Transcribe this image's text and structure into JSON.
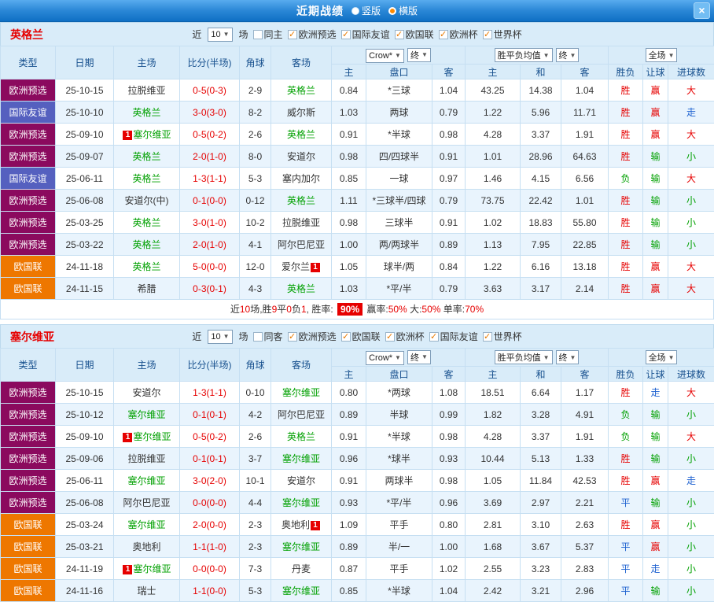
{
  "titlebar": {
    "title": "近期战绩",
    "vertical_label": "竖版",
    "horizontal_label": "横版",
    "close_glyph": "×"
  },
  "columns": {
    "main": [
      "类型",
      "日期",
      "主场",
      "比分(半场)",
      "角球",
      "客场"
    ],
    "sub": [
      "主",
      "盘口",
      "客",
      "主",
      "和",
      "客",
      "胜负",
      "让球",
      "进球数"
    ],
    "company_dd": "Crow*",
    "final_dd": "终",
    "avg_dd": "胜平负均值",
    "final_dd2": "终",
    "scope_dd": "全场"
  },
  "colors": {
    "type": {
      "欧洲预选": "#8b0a5e",
      "国际友谊": "#5560bf",
      "欧国联": "#ee7700"
    },
    "result": {
      "r": "#e60000",
      "g": "#00a000",
      "b": "#1e62d0"
    },
    "accent": "#e60000",
    "header_bg": "#d9ecf9"
  },
  "sections": [
    {
      "team": "英格兰",
      "filter": {
        "near": "近",
        "count": "10",
        "games": "场",
        "same_label": "同主",
        "same_checked": false,
        "comps": [
          "欧洲预选",
          "国际友谊",
          "欧国联",
          "欧洲杯",
          "世界杯"
        ]
      },
      "rows": [
        {
          "type": "欧洲预选",
          "date": "25-10-15",
          "home": {
            "name": "拉脱维亚"
          },
          "score": "0-5(0-3)",
          "corner": "2-9",
          "away": {
            "name": "英格兰",
            "green": true
          },
          "odds": [
            "0.84",
            "*三球",
            "1.04"
          ],
          "avg": [
            "43.25",
            "14.38",
            "1.04"
          ],
          "res": [
            "胜",
            "赢",
            "大"
          ],
          "res_c": [
            "r",
            "r",
            "r"
          ]
        },
        {
          "type": "国际友谊",
          "date": "25-10-10",
          "home": {
            "name": "英格兰",
            "green": true
          },
          "score": "3-0(3-0)",
          "corner": "8-2",
          "away": {
            "name": "威尔斯"
          },
          "odds": [
            "1.03",
            "两球",
            "0.79"
          ],
          "avg": [
            "1.22",
            "5.96",
            "11.71"
          ],
          "res": [
            "胜",
            "赢",
            "走"
          ],
          "res_c": [
            "r",
            "r",
            "b"
          ]
        },
        {
          "type": "欧洲预选",
          "date": "25-09-10",
          "home": {
            "name": "塞尔维亚",
            "green": true,
            "badge": "1",
            "badge_pos": "before"
          },
          "score": "0-5(0-2)",
          "corner": "2-6",
          "away": {
            "name": "英格兰",
            "green": true
          },
          "odds": [
            "0.91",
            "*半球",
            "0.98"
          ],
          "avg": [
            "4.28",
            "3.37",
            "1.91"
          ],
          "res": [
            "胜",
            "赢",
            "大"
          ],
          "res_c": [
            "r",
            "r",
            "r"
          ]
        },
        {
          "type": "欧洲预选",
          "date": "25-09-07",
          "home": {
            "name": "英格兰",
            "green": true
          },
          "score": "2-0(1-0)",
          "corner": "8-0",
          "away": {
            "name": "安道尔"
          },
          "odds": [
            "0.98",
            "四/四球半",
            "0.91"
          ],
          "avg": [
            "1.01",
            "28.96",
            "64.63"
          ],
          "res": [
            "胜",
            "输",
            "小"
          ],
          "res_c": [
            "r",
            "g",
            "g"
          ]
        },
        {
          "type": "国际友谊",
          "date": "25-06-11",
          "home": {
            "name": "英格兰",
            "green": true
          },
          "score": "1-3(1-1)",
          "corner": "5-3",
          "away": {
            "name": "塞内加尔"
          },
          "odds": [
            "0.85",
            "一球",
            "0.97"
          ],
          "avg": [
            "1.46",
            "4.15",
            "6.56"
          ],
          "res": [
            "负",
            "输",
            "大"
          ],
          "res_c": [
            "g",
            "g",
            "r"
          ]
        },
        {
          "type": "欧洲预选",
          "date": "25-06-08",
          "home": {
            "name": "安道尔(中)"
          },
          "score": "0-1(0-0)",
          "corner": "0-12",
          "away": {
            "name": "英格兰",
            "green": true
          },
          "odds": [
            "1.11",
            "*三球半/四球",
            "0.79"
          ],
          "avg": [
            "73.75",
            "22.42",
            "1.01"
          ],
          "res": [
            "胜",
            "输",
            "小"
          ],
          "res_c": [
            "r",
            "g",
            "g"
          ]
        },
        {
          "type": "欧洲预选",
          "date": "25-03-25",
          "home": {
            "name": "英格兰",
            "green": true
          },
          "score": "3-0(1-0)",
          "corner": "10-2",
          "away": {
            "name": "拉脱维亚"
          },
          "odds": [
            "0.98",
            "三球半",
            "0.91"
          ],
          "avg": [
            "1.02",
            "18.83",
            "55.80"
          ],
          "res": [
            "胜",
            "输",
            "小"
          ],
          "res_c": [
            "r",
            "g",
            "g"
          ]
        },
        {
          "type": "欧洲预选",
          "date": "25-03-22",
          "home": {
            "name": "英格兰",
            "green": true
          },
          "score": "2-0(1-0)",
          "corner": "4-1",
          "away": {
            "name": "阿尔巴尼亚"
          },
          "odds": [
            "1.00",
            "两/两球半",
            "0.89"
          ],
          "avg": [
            "1.13",
            "7.95",
            "22.85"
          ],
          "res": [
            "胜",
            "输",
            "小"
          ],
          "res_c": [
            "r",
            "g",
            "g"
          ]
        },
        {
          "type": "欧国联",
          "date": "24-11-18",
          "home": {
            "name": "英格兰",
            "green": true
          },
          "score": "5-0(0-0)",
          "corner": "12-0",
          "away": {
            "name": "爱尔兰",
            "badge": "1",
            "badge_pos": "after"
          },
          "odds": [
            "1.05",
            "球半/两",
            "0.84"
          ],
          "avg": [
            "1.22",
            "6.16",
            "13.18"
          ],
          "res": [
            "胜",
            "赢",
            "大"
          ],
          "res_c": [
            "r",
            "r",
            "r"
          ]
        },
        {
          "type": "欧国联",
          "date": "24-11-15",
          "home": {
            "name": "希腊"
          },
          "score": "0-3(0-1)",
          "corner": "4-3",
          "away": {
            "name": "英格兰",
            "green": true
          },
          "odds": [
            "1.03",
            "*平/半",
            "0.79"
          ],
          "avg": [
            "3.63",
            "3.17",
            "2.14"
          ],
          "res": [
            "胜",
            "赢",
            "大"
          ],
          "res_c": [
            "r",
            "r",
            "r"
          ]
        }
      ],
      "summary": [
        {
          "t": "近"
        },
        {
          "t": "10",
          "c": "red"
        },
        {
          "t": "场,胜"
        },
        {
          "t": "9",
          "c": "red"
        },
        {
          "t": "平"
        },
        {
          "t": "0",
          "c": "red"
        },
        {
          "t": "负"
        },
        {
          "t": "1",
          "c": "red"
        },
        {
          "t": ", 胜率: "
        },
        {
          "t": "90%",
          "c": "badge"
        },
        {
          "t": " 赢率:"
        },
        {
          "t": "50%",
          "c": "red"
        },
        {
          "t": " 大:"
        },
        {
          "t": "50%",
          "c": "red"
        },
        {
          "t": " 单率:"
        },
        {
          "t": "70%",
          "c": "red"
        }
      ]
    },
    {
      "team": "塞尔维亚",
      "filter": {
        "near": "近",
        "count": "10",
        "games": "场",
        "same_label": "同客",
        "same_checked": false,
        "comps": [
          "欧洲预选",
          "欧国联",
          "欧洲杯",
          "国际友谊",
          "世界杯"
        ]
      },
      "rows": [
        {
          "type": "欧洲预选",
          "date": "25-10-15",
          "home": {
            "name": "安道尔"
          },
          "score": "1-3(1-1)",
          "corner": "0-10",
          "away": {
            "name": "塞尔维亚",
            "green": true
          },
          "odds": [
            "0.80",
            "*两球",
            "1.08"
          ],
          "avg": [
            "18.51",
            "6.64",
            "1.17"
          ],
          "res": [
            "胜",
            "走",
            "大"
          ],
          "res_c": [
            "r",
            "b",
            "r"
          ]
        },
        {
          "type": "欧洲预选",
          "date": "25-10-12",
          "home": {
            "name": "塞尔维亚",
            "green": true
          },
          "score": "0-1(0-1)",
          "corner": "4-2",
          "away": {
            "name": "阿尔巴尼亚"
          },
          "odds": [
            "0.89",
            "半球",
            "0.99"
          ],
          "avg": [
            "1.82",
            "3.28",
            "4.91"
          ],
          "res": [
            "负",
            "输",
            "小"
          ],
          "res_c": [
            "g",
            "g",
            "g"
          ]
        },
        {
          "type": "欧洲预选",
          "date": "25-09-10",
          "home": {
            "name": "塞尔维亚",
            "green": true,
            "badge": "1",
            "badge_pos": "before"
          },
          "score": "0-5(0-2)",
          "corner": "2-6",
          "away": {
            "name": "英格兰",
            "green": true
          },
          "odds": [
            "0.91",
            "*半球",
            "0.98"
          ],
          "avg": [
            "4.28",
            "3.37",
            "1.91"
          ],
          "res": [
            "负",
            "输",
            "大"
          ],
          "res_c": [
            "g",
            "g",
            "r"
          ]
        },
        {
          "type": "欧洲预选",
          "date": "25-09-06",
          "home": {
            "name": "拉脱维亚"
          },
          "score": "0-1(0-1)",
          "corner": "3-7",
          "away": {
            "name": "塞尔维亚",
            "green": true
          },
          "odds": [
            "0.96",
            "*球半",
            "0.93"
          ],
          "avg": [
            "10.44",
            "5.13",
            "1.33"
          ],
          "res": [
            "胜",
            "输",
            "小"
          ],
          "res_c": [
            "r",
            "g",
            "g"
          ]
        },
        {
          "type": "欧洲预选",
          "date": "25-06-11",
          "home": {
            "name": "塞尔维亚",
            "green": true
          },
          "score": "3-0(2-0)",
          "corner": "10-1",
          "away": {
            "name": "安道尔"
          },
          "odds": [
            "0.91",
            "两球半",
            "0.98"
          ],
          "avg": [
            "1.05",
            "11.84",
            "42.53"
          ],
          "res": [
            "胜",
            "赢",
            "走"
          ],
          "res_c": [
            "r",
            "r",
            "b"
          ]
        },
        {
          "type": "欧洲预选",
          "date": "25-06-08",
          "home": {
            "name": "阿尔巴尼亚"
          },
          "score": "0-0(0-0)",
          "corner": "4-4",
          "away": {
            "name": "塞尔维亚",
            "green": true
          },
          "odds": [
            "0.93",
            "*平/半",
            "0.96"
          ],
          "avg": [
            "3.69",
            "2.97",
            "2.21"
          ],
          "res": [
            "平",
            "输",
            "小"
          ],
          "res_c": [
            "b",
            "g",
            "g"
          ]
        },
        {
          "type": "欧国联",
          "date": "25-03-24",
          "home": {
            "name": "塞尔维亚",
            "green": true
          },
          "score": "2-0(0-0)",
          "corner": "2-3",
          "away": {
            "name": "奥地利",
            "badge": "1",
            "badge_pos": "after"
          },
          "odds": [
            "1.09",
            "平手",
            "0.80"
          ],
          "avg": [
            "2.81",
            "3.10",
            "2.63"
          ],
          "res": [
            "胜",
            "赢",
            "小"
          ],
          "res_c": [
            "r",
            "r",
            "g"
          ]
        },
        {
          "type": "欧国联",
          "date": "25-03-21",
          "home": {
            "name": "奥地利"
          },
          "score": "1-1(1-0)",
          "corner": "2-3",
          "away": {
            "name": "塞尔维亚",
            "green": true
          },
          "odds": [
            "0.89",
            "半/一",
            "1.00"
          ],
          "avg": [
            "1.68",
            "3.67",
            "5.37"
          ],
          "res": [
            "平",
            "赢",
            "小"
          ],
          "res_c": [
            "b",
            "r",
            "g"
          ]
        },
        {
          "type": "欧国联",
          "date": "24-11-19",
          "home": {
            "name": "塞尔维亚",
            "green": true,
            "badge": "1",
            "badge_pos": "before"
          },
          "score": "0-0(0-0)",
          "corner": "7-3",
          "away": {
            "name": "丹麦"
          },
          "odds": [
            "0.87",
            "平手",
            "1.02"
          ],
          "avg": [
            "2.55",
            "3.23",
            "2.83"
          ],
          "res": [
            "平",
            "走",
            "小"
          ],
          "res_c": [
            "b",
            "b",
            "g"
          ]
        },
        {
          "type": "欧国联",
          "date": "24-11-16",
          "home": {
            "name": "瑞士"
          },
          "score": "1-1(0-0)",
          "corner": "5-3",
          "away": {
            "name": "塞尔维亚",
            "green": true
          },
          "odds": [
            "0.85",
            "*半球",
            "1.04"
          ],
          "avg": [
            "2.42",
            "3.21",
            "2.96"
          ],
          "res": [
            "平",
            "输",
            "小"
          ],
          "res_c": [
            "b",
            "g",
            "g"
          ]
        }
      ],
      "summary": null
    }
  ]
}
